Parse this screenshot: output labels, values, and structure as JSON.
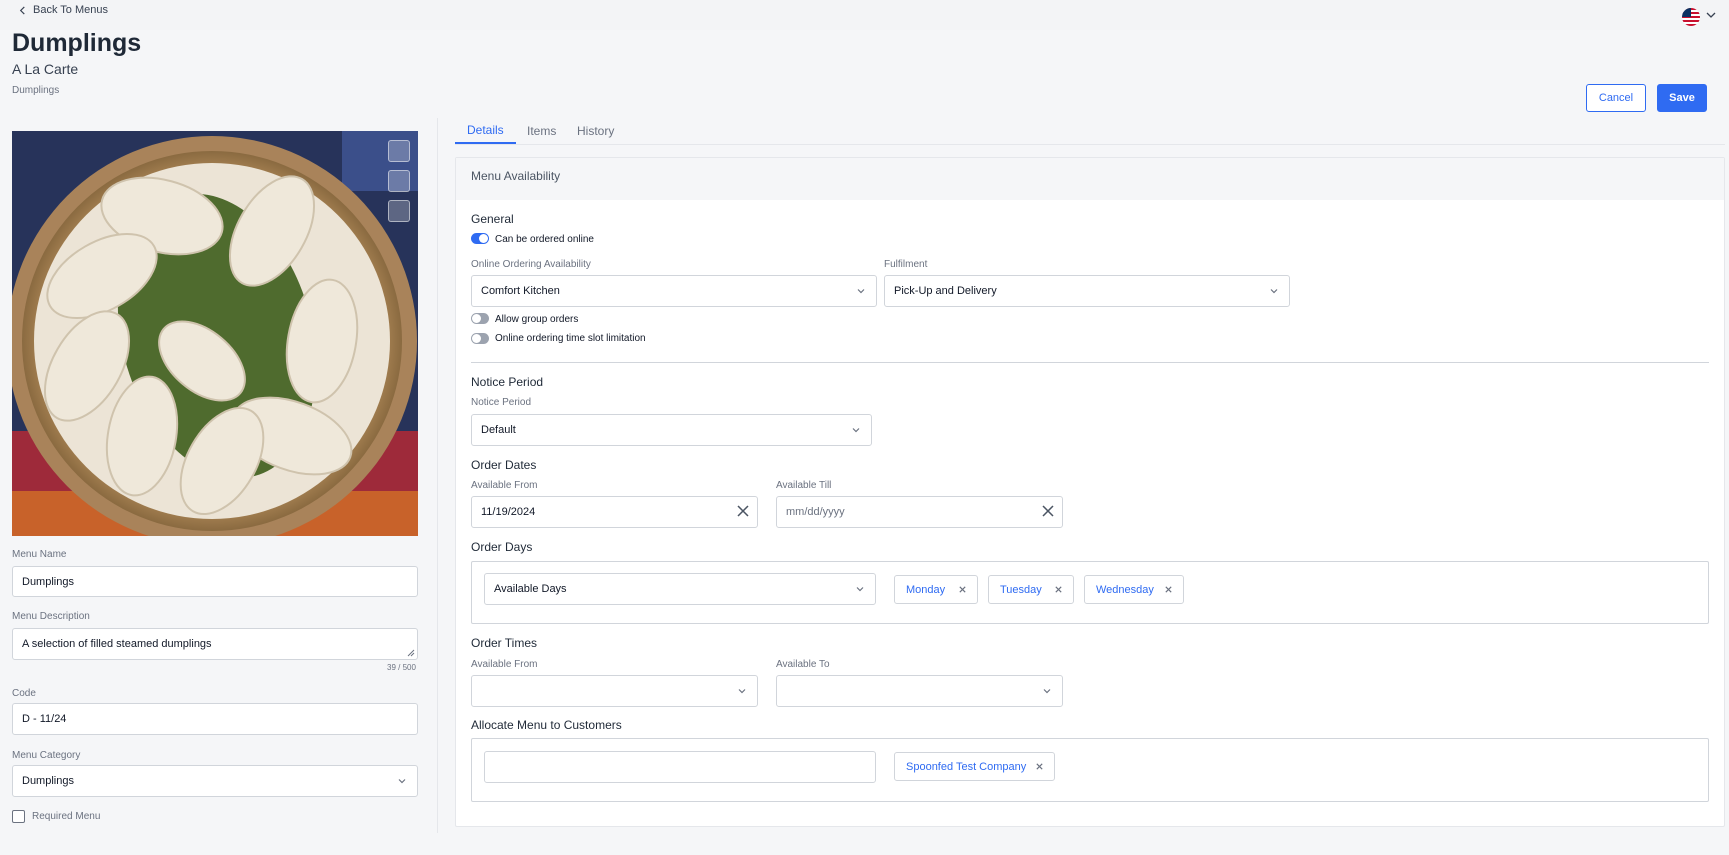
{
  "header": {
    "back_label": "Back To Menus",
    "title": "Dumplings",
    "subtitle": "A La Carte",
    "breadcrumb": "Dumplings",
    "cancel_label": "Cancel",
    "save_label": "Save",
    "language_icon": "us-flag-icon"
  },
  "left": {
    "menu_name_label": "Menu Name",
    "menu_name_value": "Dumplings",
    "menu_description_label": "Menu Description",
    "menu_description_value": "A selection of filled steamed dumplings",
    "description_counter": "39 / 500",
    "code_label": "Code",
    "code_value": "D - 11/24",
    "menu_category_label": "Menu Category",
    "menu_category_value": "Dumplings",
    "required_menu_label": "Required Menu"
  },
  "tabs": [
    {
      "label": "Details"
    },
    {
      "label": "Items"
    },
    {
      "label": "History"
    }
  ],
  "panel": {
    "title": "Menu Availability",
    "general": {
      "heading": "General",
      "can_order_online_label": "Can be ordered online",
      "online_ordering_label": "Online Ordering Availability",
      "online_ordering_value": "Comfort Kitchen",
      "fulfilment_label": "Fulfilment",
      "fulfilment_value": "Pick-Up and Delivery",
      "allow_group_orders_label": "Allow group orders",
      "time_slot_label": "Online ordering time slot limitation"
    },
    "notice": {
      "heading": "Notice Period",
      "label": "Notice Period",
      "value": "Default"
    },
    "order_dates": {
      "heading": "Order Dates",
      "from_label": "Available From",
      "from_value": "11/19/2024",
      "till_label": "Available Till",
      "till_placeholder": "mm/dd/yyyy"
    },
    "order_days": {
      "heading": "Order Days",
      "select_value": "Available Days",
      "days": [
        "Monday",
        "Tuesday",
        "Wednesday"
      ]
    },
    "order_times": {
      "heading": "Order Times",
      "from_label": "Available From",
      "to_label": "Available To"
    },
    "customers": {
      "heading": "Allocate Menu to Customers",
      "chips": [
        "Spoonfed Test Company"
      ]
    }
  },
  "colors": {
    "accent": "#2f6bf2",
    "page_bg": "#f5f6f8"
  }
}
